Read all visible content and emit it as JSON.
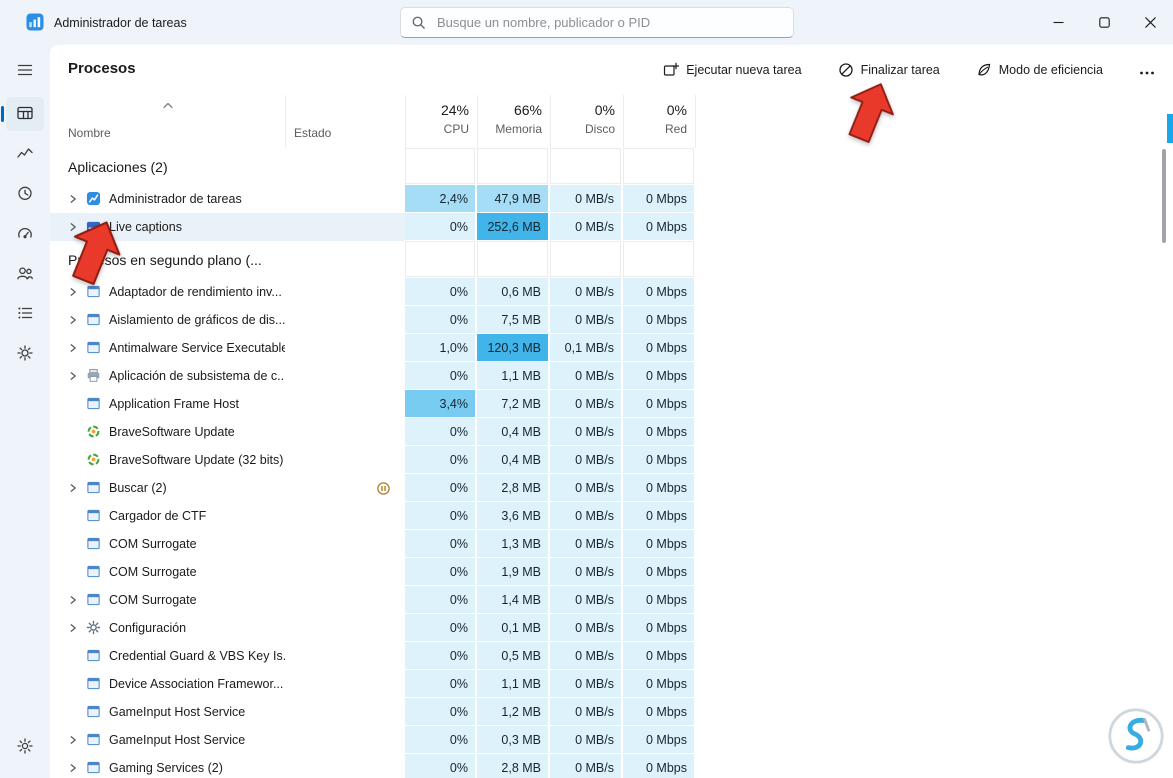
{
  "window": {
    "title": "Administrador de tareas",
    "search_placeholder": "Busque un nombre, publicador o PID"
  },
  "sidebar": {
    "items": [
      {
        "id": "menu-toggle",
        "icon": "hamburger-icon"
      },
      {
        "id": "processes",
        "icon": "processes-icon",
        "selected": true
      },
      {
        "id": "performance",
        "icon": "performance-icon"
      },
      {
        "id": "app-history",
        "icon": "app-history-icon"
      },
      {
        "id": "startup-apps",
        "icon": "startup-icon"
      },
      {
        "id": "users",
        "icon": "users-icon"
      },
      {
        "id": "details",
        "icon": "details-icon"
      },
      {
        "id": "services",
        "icon": "services-icon"
      },
      {
        "id": "settings",
        "icon": "settings-icon"
      }
    ]
  },
  "header": {
    "title": "Procesos",
    "actions": [
      {
        "id": "run-new-task",
        "label": "Ejecutar nueva tarea"
      },
      {
        "id": "end-task",
        "label": "Finalizar tarea"
      },
      {
        "id": "efficiency-mode",
        "label": "Modo de eficiencia"
      }
    ]
  },
  "table": {
    "sort": {
      "column": "Nombre",
      "direction": "asc"
    },
    "columns": {
      "name": "Nombre",
      "status": "Estado",
      "cpu_pct": "24%",
      "cpu_label": "CPU",
      "mem_pct": "66%",
      "mem_label": "Memoria",
      "disk_pct": "0%",
      "disk_label": "Disco",
      "net_pct": "0%",
      "net_label": "Red"
    },
    "rows": [
      {
        "type": "group",
        "name": "Aplicaciones (2)"
      },
      {
        "type": "process",
        "name": "Administrador de tareas",
        "icon": "taskmgr",
        "expandable": true,
        "cpu": "2,4%",
        "mem": "47,9 MB",
        "disk": "0 MB/s",
        "net": "0 Mbps",
        "heat": [
          1,
          1,
          0,
          0
        ]
      },
      {
        "type": "process",
        "name": "Live captions",
        "icon": "captions",
        "expandable": true,
        "selected": true,
        "cpu": "0%",
        "mem": "252,6 MB",
        "disk": "0 MB/s",
        "net": "0 Mbps",
        "heat": [
          0,
          3,
          0,
          0
        ]
      },
      {
        "type": "group",
        "name": "Procesos en segundo plano (..."
      },
      {
        "type": "process",
        "name": "Adaptador de rendimiento inv...",
        "icon": "window",
        "expandable": true,
        "cpu": "0%",
        "mem": "0,6 MB",
        "disk": "0 MB/s",
        "net": "0 Mbps",
        "heat": [
          0,
          0,
          0,
          0
        ]
      },
      {
        "type": "process",
        "name": "Aislamiento de gráficos de dis...",
        "icon": "window",
        "expandable": true,
        "cpu": "0%",
        "mem": "7,5 MB",
        "disk": "0 MB/s",
        "net": "0 Mbps",
        "heat": [
          0,
          0,
          0,
          0
        ]
      },
      {
        "type": "process",
        "name": "Antimalware Service Executable",
        "icon": "window",
        "expandable": true,
        "cpu": "1,0%",
        "mem": "120,3 MB",
        "disk": "0,1 MB/s",
        "net": "0 Mbps",
        "heat": [
          0,
          3,
          0,
          0
        ]
      },
      {
        "type": "process",
        "name": "Aplicación de subsistema de c...",
        "icon": "printer",
        "expandable": true,
        "cpu": "0%",
        "mem": "1,1 MB",
        "disk": "0 MB/s",
        "net": "0 Mbps",
        "heat": [
          0,
          0,
          0,
          0
        ]
      },
      {
        "type": "process",
        "name": "Application Frame Host",
        "icon": "window",
        "cpu": "3,4%",
        "mem": "7,2 MB",
        "disk": "0 MB/s",
        "net": "0 Mbps",
        "heat": [
          2,
          0,
          0,
          0
        ]
      },
      {
        "type": "process",
        "name": "BraveSoftware Update",
        "icon": "updater",
        "cpu": "0%",
        "mem": "0,4 MB",
        "disk": "0 MB/s",
        "net": "0 Mbps",
        "heat": [
          0,
          0,
          0,
          0
        ]
      },
      {
        "type": "process",
        "name": "BraveSoftware Update (32 bits)",
        "icon": "updater",
        "cpu": "0%",
        "mem": "0,4 MB",
        "disk": "0 MB/s",
        "net": "0 Mbps",
        "heat": [
          0,
          0,
          0,
          0
        ]
      },
      {
        "type": "process",
        "name": "Buscar (2)",
        "icon": "window",
        "expandable": true,
        "status": "suspended",
        "cpu": "0%",
        "mem": "2,8 MB",
        "disk": "0 MB/s",
        "net": "0 Mbps",
        "heat": [
          0,
          0,
          0,
          0
        ]
      },
      {
        "type": "process",
        "name": "Cargador de CTF",
        "icon": "window",
        "cpu": "0%",
        "mem": "3,6 MB",
        "disk": "0 MB/s",
        "net": "0 Mbps",
        "heat": [
          0,
          0,
          0,
          0
        ]
      },
      {
        "type": "process",
        "name": "COM Surrogate",
        "icon": "window",
        "cpu": "0%",
        "mem": "1,3 MB",
        "disk": "0 MB/s",
        "net": "0 Mbps",
        "heat": [
          0,
          0,
          0,
          0
        ]
      },
      {
        "type": "process",
        "name": "COM Surrogate",
        "icon": "window",
        "cpu": "0%",
        "mem": "1,9 MB",
        "disk": "0 MB/s",
        "net": "0 Mbps",
        "heat": [
          0,
          0,
          0,
          0
        ]
      },
      {
        "type": "process",
        "name": "COM Surrogate",
        "icon": "window",
        "expandable": true,
        "cpu": "0%",
        "mem": "1,4 MB",
        "disk": "0 MB/s",
        "net": "0 Mbps",
        "heat": [
          0,
          0,
          0,
          0
        ]
      },
      {
        "type": "process",
        "name": "Configuración",
        "icon": "gear",
        "expandable": true,
        "cpu": "0%",
        "mem": "0,1 MB",
        "disk": "0 MB/s",
        "net": "0 Mbps",
        "heat": [
          0,
          0,
          0,
          0
        ]
      },
      {
        "type": "process",
        "name": "Credential Guard & VBS Key Is...",
        "icon": "window",
        "cpu": "0%",
        "mem": "0,5 MB",
        "disk": "0 MB/s",
        "net": "0 Mbps",
        "heat": [
          0,
          0,
          0,
          0
        ]
      },
      {
        "type": "process",
        "name": "Device Association Framewor...",
        "icon": "window",
        "cpu": "0%",
        "mem": "1,1 MB",
        "disk": "0 MB/s",
        "net": "0 Mbps",
        "heat": [
          0,
          0,
          0,
          0
        ]
      },
      {
        "type": "process",
        "name": "GameInput Host Service",
        "icon": "window",
        "cpu": "0%",
        "mem": "1,2 MB",
        "disk": "0 MB/s",
        "net": "0 Mbps",
        "heat": [
          0,
          0,
          0,
          0
        ]
      },
      {
        "type": "process",
        "name": "GameInput Host Service",
        "icon": "window",
        "expandable": true,
        "cpu": "0%",
        "mem": "0,3 MB",
        "disk": "0 MB/s",
        "net": "0 Mbps",
        "heat": [
          0,
          0,
          0,
          0
        ]
      },
      {
        "type": "process",
        "name": "Gaming Services (2)",
        "icon": "window",
        "expandable": true,
        "cpu": "0%",
        "mem": "2,8 MB",
        "disk": "0 MB/s",
        "net": "0 Mbps",
        "heat": [
          0,
          0,
          0,
          0
        ]
      }
    ]
  },
  "colors": {
    "accent": "#0067c0",
    "heat": [
      "#def2fc",
      "#a5dcf6",
      "#79ccf1",
      "#41b4e9"
    ],
    "selected_row": "#eaf2f9",
    "arrow": "#e8392b",
    "suspended": "#b07a1f"
  },
  "annotations": {
    "arrow_targets": [
      "Finalizar tarea",
      "Live captions"
    ]
  }
}
